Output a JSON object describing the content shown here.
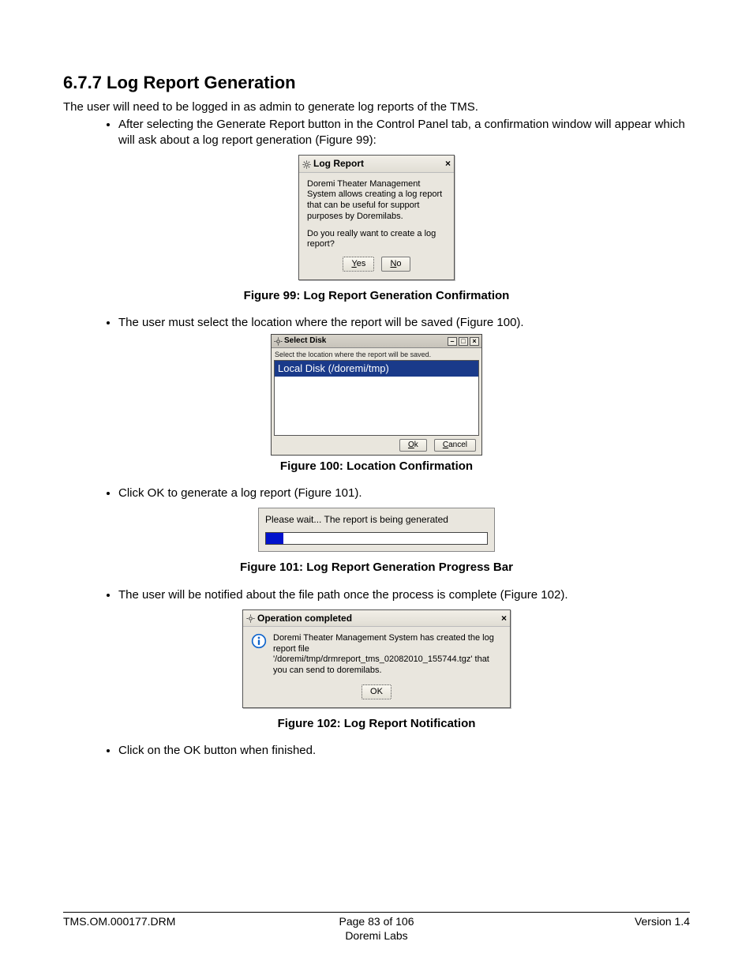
{
  "heading": "6.7.7  Log Report Generation",
  "intro": "The user will need to be logged in as admin to generate log reports of the TMS.",
  "bullets": {
    "b1": "After selecting the Generate Report button in the Control Panel tab, a confirmation window will appear which will ask about a log report generation (Figure 99):",
    "b2": "The user must select the location where the report will be saved (Figure 100).",
    "b3": "Click OK to generate a log report (Figure 101).",
    "b4": "The user will be notified about the file path once the process is complete (Figure 102).",
    "b5": "Click on the OK button when finished."
  },
  "captions": {
    "c99": "Figure 99: Log Report Generation Confirmation",
    "c100": "Figure 100: Location Confirmation",
    "c101": "Figure 101: Log Report Generation Progress Bar",
    "c102": "Figure 102: Log Report Notification"
  },
  "dlg99": {
    "title": "Log Report",
    "p1": "Doremi Theater Management System allows creating a log report that can be useful for support purposes by Doremilabs.",
    "p2": "Do you really want to create a log report?",
    "yes_pre": "Y",
    "yes_post": "es",
    "no_pre": "N",
    "no_post": "o"
  },
  "dlg100": {
    "title": "Select Disk",
    "instr": "Select the location where the report will be saved.",
    "item": "Local Disk (/doremi/tmp)",
    "ok_pre": "O",
    "ok_post": "k",
    "cancel_pre": "C",
    "cancel_post": "ancel"
  },
  "dlg101": {
    "msg": "Please wait... The report is being generated"
  },
  "dlg102": {
    "title": "Operation completed",
    "body": "Doremi Theater Management System has created the log report file '/doremi/tmp/drmreport_tms_02082010_155744.tgz' that you can send to doremilabs.",
    "ok": "OK"
  },
  "footer": {
    "left": "TMS.OM.000177.DRM",
    "center": "Page 83 of 106",
    "right": "Version 1.4",
    "sub": "Doremi Labs"
  }
}
